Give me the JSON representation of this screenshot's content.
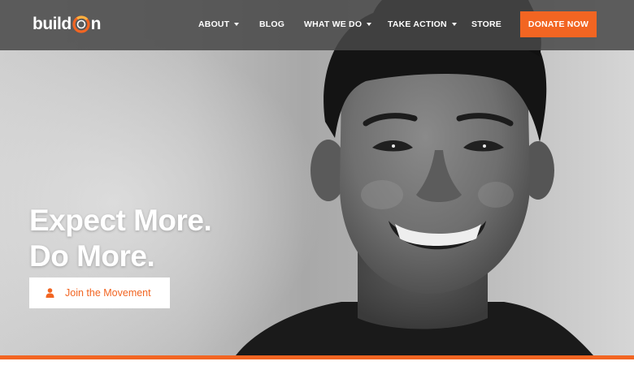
{
  "brand": {
    "logo_prefix": "build",
    "logo_suffix": "n",
    "accent_color": "#f26522",
    "header_color": "#484848"
  },
  "nav": {
    "items": [
      {
        "label": "ABOUT",
        "has_dropdown": true
      },
      {
        "label": "BLOG",
        "has_dropdown": false
      },
      {
        "label": "WHAT WE DO",
        "has_dropdown": true
      },
      {
        "label": "TAKE ACTION",
        "has_dropdown": true
      },
      {
        "label": "STORE",
        "has_dropdown": false
      }
    ],
    "donate_label": "DONATE NOW"
  },
  "hero": {
    "headline_line1": "Expect More.",
    "headline_line2": "Do More.",
    "cta_label": "Join the Movement",
    "cta_icon": "person-icon",
    "photo_subject": "smiling-boy-portrait"
  }
}
